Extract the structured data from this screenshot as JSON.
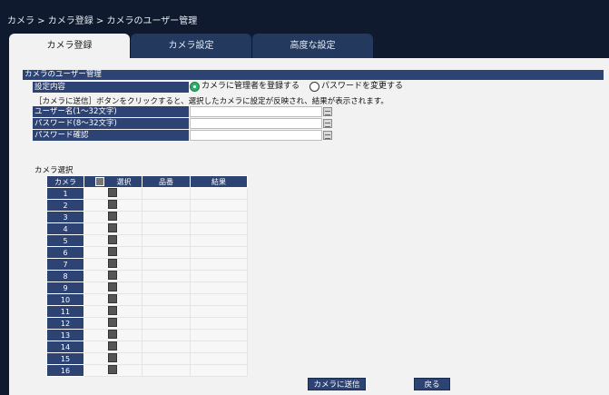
{
  "breadcrumb": "カメラ > カメラ登録 > カメラのユーザー管理",
  "tabs": [
    {
      "label": "カメラ登録",
      "active": true
    },
    {
      "label": "カメラ設定",
      "active": false
    },
    {
      "label": "高度な設定",
      "active": false
    }
  ],
  "section": {
    "title": "カメラのユーザー管理",
    "setting_label": "設定内容",
    "radio_register": "カメラに管理者を登録する",
    "radio_change_pw": "パスワードを変更する",
    "radio_selected": "register",
    "note": "［カメラに送信］ボタンをクリックすると、選択したカメラに設定が反映され、結果が表示されます。",
    "username_label": "ユーザー名(1〜32文字)",
    "password_label": "パスワード(8〜32文字)",
    "password_confirm_label": "パスワード確認",
    "username_value": "",
    "password_value": "",
    "password_confirm_value": ""
  },
  "camera_select": {
    "label": "カメラ選択",
    "headers": {
      "camera": "カメラ",
      "select": "選択",
      "model": "品番",
      "result": "結果"
    },
    "rows": [
      "1",
      "2",
      "3",
      "4",
      "5",
      "6",
      "7",
      "8",
      "9",
      "10",
      "11",
      "12",
      "13",
      "14",
      "15",
      "16"
    ]
  },
  "buttons": {
    "send": "カメラに送信",
    "back": "戻る"
  },
  "icons": {
    "keyboard": "keyboard-icon"
  }
}
